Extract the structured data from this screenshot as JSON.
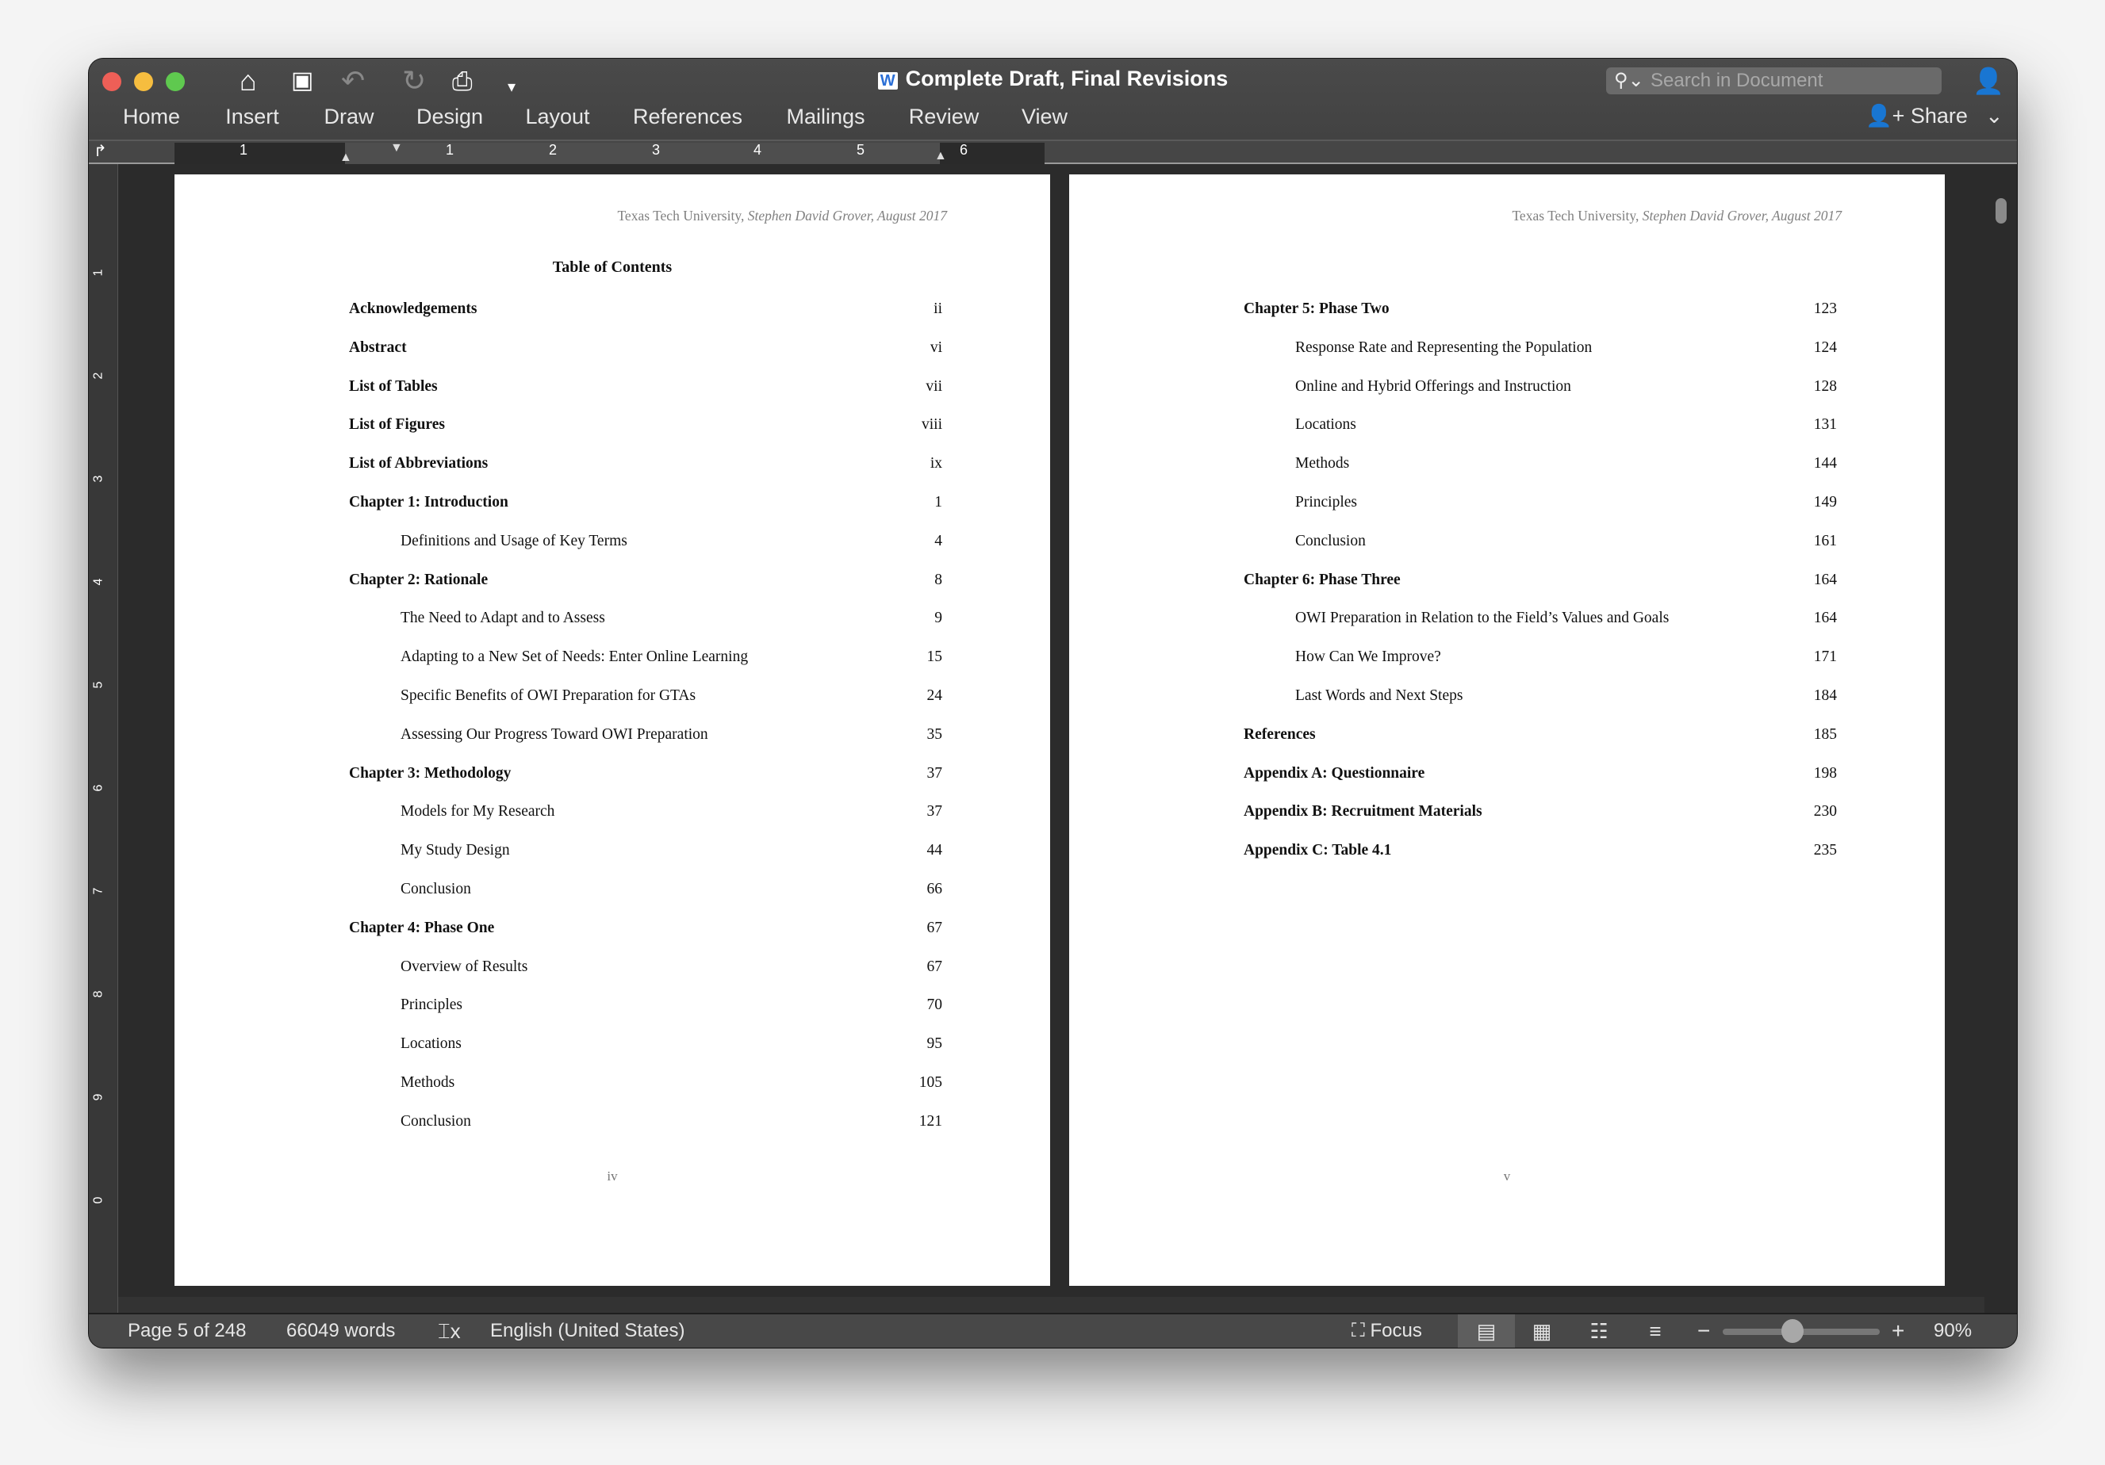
{
  "window": {
    "title": "Complete Draft, Final Revisions",
    "search_placeholder": "Search in Document",
    "share_label": "Share"
  },
  "colors": {
    "close": "#ee5f57",
    "minimize": "#f6bd3f",
    "zoom": "#5fc94f",
    "chrome": "#444444",
    "doc_bg": "#2b2b2b"
  },
  "toolbar_icons": [
    "home-icon",
    "save-icon",
    "undo-icon",
    "redo-icon",
    "print-icon",
    "customize-toolbar-icon"
  ],
  "tabs": [
    "Home",
    "Insert",
    "Draw",
    "Design",
    "Layout",
    "References",
    "Mailings",
    "Review",
    "View"
  ],
  "ruler": {
    "labels": [
      "1",
      "1",
      "2",
      "3",
      "4",
      "5",
      "6"
    ],
    "vertical_labels": [
      "1",
      "2",
      "3",
      "4",
      "5",
      "6",
      "7",
      "8",
      "9",
      "0"
    ]
  },
  "pages": [
    {
      "header_plain": "Texas Tech University, ",
      "header_italic": "Stephen David Grover, August 2017",
      "title": "Table of Contents",
      "footer": "iv",
      "entries": [
        {
          "level": 1,
          "text": "Acknowledgements",
          "page": "ii"
        },
        {
          "level": 1,
          "text": "Abstract",
          "page": "vi"
        },
        {
          "level": 1,
          "text": "List of Tables",
          "page": "vii"
        },
        {
          "level": 1,
          "text": "List of Figures",
          "page": "viii"
        },
        {
          "level": 1,
          "text": "List of Abbreviations",
          "page": "ix"
        },
        {
          "level": 1,
          "text": "Chapter 1: Introduction",
          "page": "1"
        },
        {
          "level": 2,
          "text": "Definitions and Usage of Key Terms",
          "page": "4"
        },
        {
          "level": 1,
          "text": "Chapter 2: Rationale",
          "page": "8"
        },
        {
          "level": 2,
          "text": "The Need to Adapt and to Assess",
          "page": "9"
        },
        {
          "level": 2,
          "text": "Adapting to a New Set of Needs: Enter Online Learning",
          "page": "15"
        },
        {
          "level": 2,
          "text": "Specific Benefits of OWI Preparation for GTAs",
          "page": "24"
        },
        {
          "level": 2,
          "text": "Assessing Our Progress Toward OWI Preparation",
          "page": "35"
        },
        {
          "level": 1,
          "text": "Chapter 3: Methodology",
          "page": "37"
        },
        {
          "level": 2,
          "text": "Models for My Research",
          "page": "37"
        },
        {
          "level": 2,
          "text": "My Study Design",
          "page": "44"
        },
        {
          "level": 2,
          "text": "Conclusion",
          "page": "66"
        },
        {
          "level": 1,
          "text": "Chapter 4: Phase One",
          "page": "67"
        },
        {
          "level": 2,
          "text": "Overview of Results",
          "page": "67"
        },
        {
          "level": 2,
          "text": "Principles",
          "page": "70"
        },
        {
          "level": 2,
          "text": "Locations",
          "page": "95"
        },
        {
          "level": 2,
          "text": "Methods",
          "page": "105"
        },
        {
          "level": 2,
          "text": "Conclusion",
          "page": "121"
        }
      ]
    },
    {
      "header_plain": "Texas Tech University, ",
      "header_italic": "Stephen David Grover, August 2017",
      "title": "",
      "footer": "v",
      "entries": [
        {
          "level": 1,
          "text": "Chapter 5: Phase Two",
          "page": "123"
        },
        {
          "level": 2,
          "text": "Response Rate and Representing the Population",
          "page": "124"
        },
        {
          "level": 2,
          "text": "Online and Hybrid Offerings and Instruction",
          "page": "128"
        },
        {
          "level": 2,
          "text": "Locations",
          "page": "131"
        },
        {
          "level": 2,
          "text": "Methods",
          "page": "144"
        },
        {
          "level": 2,
          "text": "Principles",
          "page": "149"
        },
        {
          "level": 2,
          "text": "Conclusion",
          "page": "161"
        },
        {
          "level": 1,
          "text": "Chapter 6: Phase Three",
          "page": "164"
        },
        {
          "level": 2,
          "text": "OWI Preparation in Relation to the Field’s Values and Goals",
          "page": "164"
        },
        {
          "level": 2,
          "text": "How Can We Improve?",
          "page": "171"
        },
        {
          "level": 2,
          "text": "Last Words and Next Steps",
          "page": "184"
        },
        {
          "level": 1,
          "text": "References",
          "page": "185"
        },
        {
          "level": 1,
          "text": "Appendix A: Questionnaire",
          "page": "198"
        },
        {
          "level": 1,
          "text": "Appendix B: Recruitment Materials",
          "page": "230"
        },
        {
          "level": 1,
          "text": "Appendix C: Table 4.1",
          "page": "235"
        }
      ]
    }
  ],
  "status": {
    "page": "Page 5 of 248",
    "words": "66049 words",
    "language": "English (United States)",
    "focus": "Focus",
    "zoom_percent": "90%",
    "zoom_value": 90
  }
}
